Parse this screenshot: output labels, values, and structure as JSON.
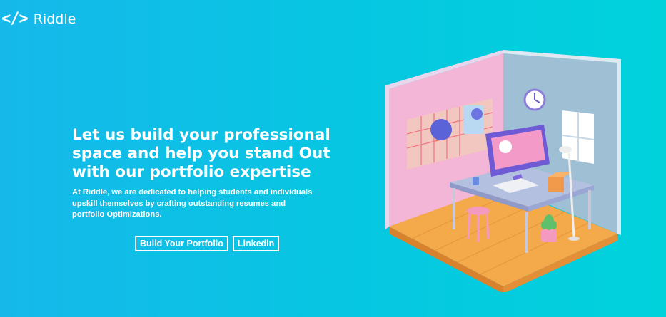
{
  "brand": {
    "icon": "</>",
    "name": "Riddle"
  },
  "hero": {
    "headline_lines": [
      "Let us build your professional",
      "space and help you stand Out",
      "with our portfolio expertise"
    ],
    "description_lines": [
      "At Riddle, we are dedicated to helping students and individuals",
      "upskill themselves by crafting outstanding resumes and",
      "portfolio Optimizations."
    ],
    "buttons": {
      "primary": "Build Your Portfolio",
      "secondary": "Linkedin"
    }
  },
  "illustration": {
    "icon": "isometric-room-illustration"
  },
  "colors": {
    "bg_start": "#16b8ea",
    "bg_end": "#00d2dc",
    "text": "#ffffff"
  }
}
